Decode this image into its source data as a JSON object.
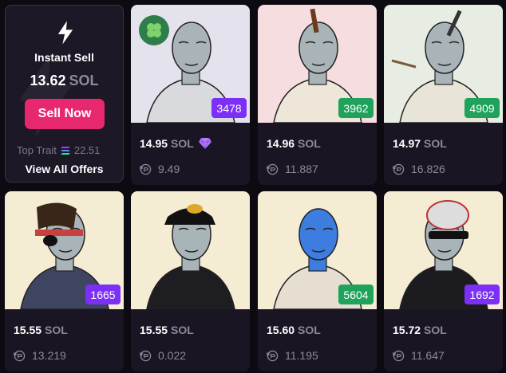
{
  "instant_sell": {
    "title": "Instant Sell",
    "price_value": "13.62",
    "price_unit": "SOL",
    "button_label": "Sell Now",
    "top_trait_label": "Top Trait",
    "top_trait_value": "22.51",
    "view_all_label": "View All Offers"
  },
  "listings": [
    {
      "rank": "3478",
      "price": "14.95",
      "unit": "SOL",
      "last_sale": "9.49",
      "bg": "#e4e2ec",
      "badge_color": "#7b2ff7",
      "rare_gem": true,
      "clover": true
    },
    {
      "rank": "3962",
      "price": "14.96",
      "unit": "SOL",
      "last_sale": "11.887",
      "bg": "#f5dde0",
      "badge_color": "#1fa35c"
    },
    {
      "rank": "4909",
      "price": "14.97",
      "unit": "SOL",
      "last_sale": "16.826",
      "bg": "#e8ede4",
      "badge_color": "#1fa35c"
    },
    {
      "rank": "1665",
      "price": "15.55",
      "unit": "SOL",
      "last_sale": "13.219",
      "bg": "#f5ecd4",
      "badge_color": "#7b2ff7"
    },
    {
      "rank": "",
      "price": "15.55",
      "unit": "SOL",
      "last_sale": "0.022",
      "bg": "#f5ecd4",
      "badge_color": ""
    },
    {
      "rank": "5604",
      "price": "15.60",
      "unit": "SOL",
      "last_sale": "11.195",
      "bg": "#f5ecd4",
      "badge_color": "#1fa35c"
    },
    {
      "rank": "1692",
      "price": "15.72",
      "unit": "SOL",
      "last_sale": "11.647",
      "bg": "#f5ecd4",
      "badge_color": "#7b2ff7"
    }
  ]
}
